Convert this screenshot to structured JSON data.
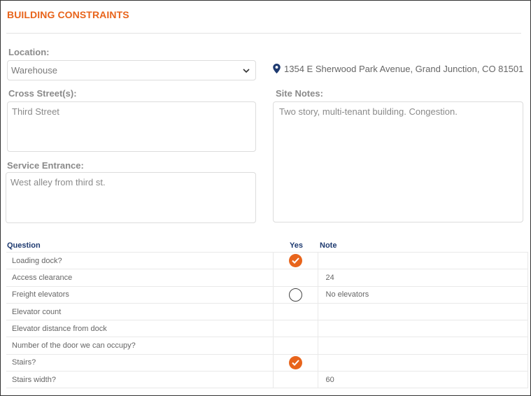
{
  "section_title": "BUILDING CONSTRAINTS",
  "colors": {
    "accent": "#e8641b",
    "header_text": "#1e3a70"
  },
  "location": {
    "label": "Location:",
    "selected": "Warehouse",
    "address": "1354 E Sherwood Park Avenue, Grand Junction, CO 81501",
    "pin_icon": "map-pin-icon"
  },
  "cross_streets": {
    "label": "Cross Street(s):",
    "value": "Third Street"
  },
  "site_notes": {
    "label": "Site Notes:",
    "value": "Two story, multi-tenant building. Congestion."
  },
  "service_entrance": {
    "label": "Service Entrance:",
    "value": "West alley from third st."
  },
  "table": {
    "headers": {
      "question": "Question",
      "yes": "Yes",
      "note": "Note"
    },
    "rows": [
      {
        "question": "Loading dock?",
        "yes": "checked",
        "note": ""
      },
      {
        "question": "Access clearance",
        "yes": "none",
        "note": "24"
      },
      {
        "question": "Freight elevators",
        "yes": "unchecked",
        "note": "No elevators"
      },
      {
        "question": "Elevator count",
        "yes": "none",
        "note": ""
      },
      {
        "question": "Elevator distance from dock",
        "yes": "none",
        "note": ""
      },
      {
        "question": "Number of the door we can occupy?",
        "yes": "none",
        "note": ""
      },
      {
        "question": "Stairs?",
        "yes": "checked",
        "note": ""
      },
      {
        "question": "Stairs width?",
        "yes": "none",
        "note": "60"
      }
    ]
  }
}
